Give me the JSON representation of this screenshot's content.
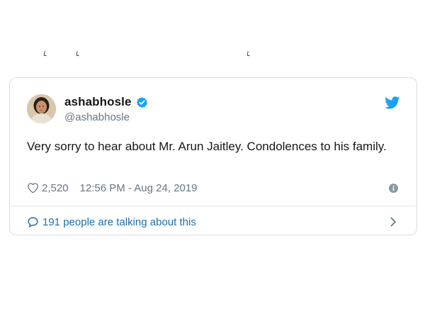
{
  "tweet": {
    "display_name": "ashabhosle",
    "handle": "@ashabhosle",
    "text": "Very sorry to hear about Mr. Arun Jaitley. Condolences to his family.",
    "like_count": "2,520",
    "timestamp": "12:56 PM - Aug 24, 2019",
    "conversation_label": "191 people are talking about this"
  },
  "icons": {
    "verified": "verified-badge",
    "brand": "twitter-bird",
    "like": "heart-outline",
    "info": "info-circle",
    "reply": "speech-bubble",
    "chevron": "chevron-right"
  },
  "colors": {
    "twitter_blue": "#1da1f2",
    "link_blue": "#1b6fae",
    "text_primary": "#14171a",
    "text_secondary": "#657786",
    "border": "#d8dde2"
  }
}
